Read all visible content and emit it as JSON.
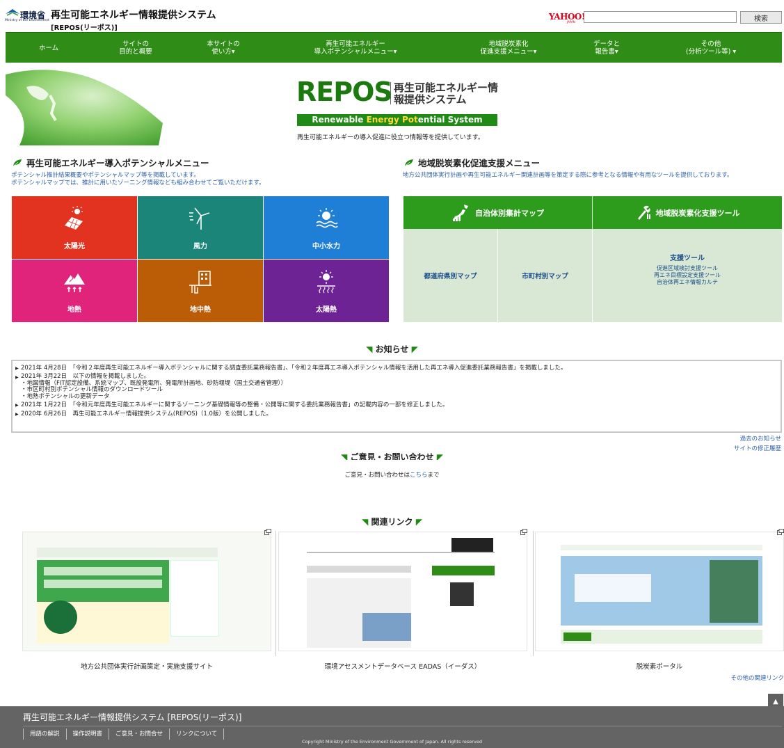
{
  "header": {
    "ministry": "環境省",
    "ministry_en": "Ministry of the Environment",
    "site_title": "再生可能エネルギー情報提供システム",
    "site_sub": "[REPOS(リーポス)]",
    "yahoo": "YAHOO!",
    "yahoo_sub": "JAPAN",
    "search_value": "",
    "search_button": "検索"
  },
  "nav": [
    {
      "label": "ホーム"
    },
    {
      "label": "サイトの\n目的と概要"
    },
    {
      "label": "本サイトの\n使い方▾"
    },
    {
      "label": "再生可能エネルギー\n導入ポテンシャルメニュー▾"
    },
    {
      "label": "地域脱炭素化\n促進支援メニュー▾"
    },
    {
      "label": "データと\n報告書▾"
    },
    {
      "label": "その他\n(分析ツール等) ▾"
    }
  ],
  "hero": {
    "logo": "REPOS",
    "title": "再生可能エネルギー情報提供システム",
    "band_part1": "Renewable ",
    "band_part2": "Energy ",
    "band_part3": "Pot",
    "band_part4": "ential System",
    "tagline": "再生可能エネルギーの導入促進に役立つ情報等を提供しています。"
  },
  "potential": {
    "heading": "再生可能エネルギー導入ポテンシャルメニュー",
    "desc1": "ポテンシャル推計結果概要やポテンシャルマップ等を掲載しています。",
    "desc2": "ポテンシャルマップでは、推計に用いたゾーニング情報なども組み合わせてご覧いただけます。",
    "tiles": [
      {
        "label": "太陽光",
        "color": "#e23220",
        "icon": "solar-panel-icon"
      },
      {
        "label": "風力",
        "color": "#1a8578",
        "icon": "wind-turbine-icon"
      },
      {
        "label": "中小水力",
        "color": "#1f7fd6",
        "icon": "hydro-icon"
      },
      {
        "label": "地熱",
        "color": "#e0247b",
        "icon": "geothermal-icon"
      },
      {
        "label": "地中熱",
        "color": "#bb5c07",
        "icon": "ground-heat-icon"
      },
      {
        "label": "太陽熱",
        "color": "#6e2395",
        "icon": "solar-heat-icon"
      }
    ]
  },
  "decarb": {
    "heading": "地域脱炭素化促進支援メニュー",
    "desc": "地方公共団体実行計画や再生可能エネルギー関連計画等を策定する際に参考となる情報や有用なツールを提供しております。",
    "map_head": "自治体別集計マップ",
    "tool_head": "地域脱炭素化支援ツール",
    "pref_map": "都道府県別マップ",
    "city_map": "市町村別マップ",
    "tools_title": "支援ツール",
    "tools_items": [
      "促進区域検討支援ツール",
      "再エネ目標設定支援ツール",
      "自治体再エネ情報カルテ"
    ]
  },
  "notice": {
    "heading": "お知らせ",
    "items": [
      {
        "text": "2021年 4月28日　「令和２年度再生可能エネルギー導入ポテンシャルに関する調査委託業務報告書」、「令和２年度再エネ導入ポテンシャル情報を活用した再エネ導入促進委託業務報告書」を掲載しました。"
      },
      {
        "text": "2021年 3月22日　以下の情報を掲載しました。\n・地図情報（FIT認定設備、系統マップ、既設発電所、発電所計画地、砂防堰堤（国土交通省管理））\n・市区町村別ポテンシャル情報のダウンロードツール\n・地熱ポテンシャルの更新データ"
      },
      {
        "text": "2021年 1月22日　「令和元年度再生可能エネルギーに関するゾーニング基礎情報等の整備・公開等に関する委託業務報告書」の記載内容の一部を修正しました。"
      },
      {
        "text": "2020年 6月26日　再生可能エネルギー情報提供システム(REPOS)（1.0版）を公開しました。"
      }
    ],
    "past_link": "過去のお知らせ",
    "revision_link": "サイトの修正履歴"
  },
  "contact": {
    "heading": "ご意見・お問い合わせ",
    "text_before": "ご意見・お問い合わせは",
    "link": "こちら",
    "text_after": "まで"
  },
  "links": {
    "heading": "関連リンク",
    "cards": [
      {
        "caption": "地方公共団体実行計画策定・実施支援サイト"
      },
      {
        "caption": "環境アセスメントデータベース EADAS（イーダス）"
      },
      {
        "caption": "脱炭素ポータル"
      }
    ],
    "other": "その他の関連リンク"
  },
  "footer": {
    "title": "再生可能エネルギー情報提供システム [REPOS(リーポス)]",
    "nav": [
      "用語の解説",
      "操作説明書",
      "ご意見・お問合せ",
      "リンクについて"
    ],
    "copyright": "Copyright Ministry of the Environment Government of Japan. All rights reserved",
    "scroll_top": "▲"
  },
  "colors": {
    "nav_green": "#2f8d17",
    "brand_green": "#1b7a0e",
    "link_blue": "#2a5ea8"
  }
}
